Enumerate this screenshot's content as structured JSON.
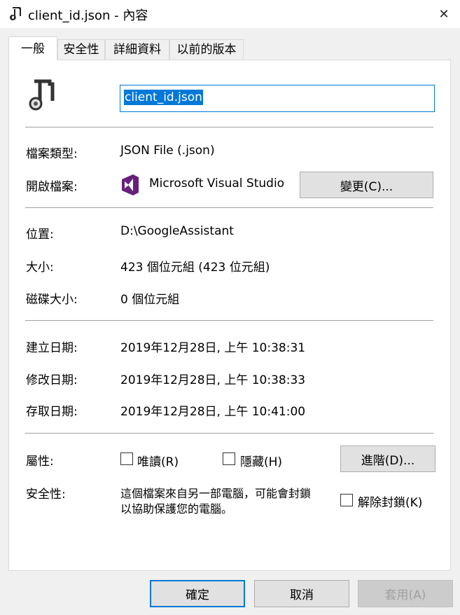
{
  "window": {
    "title": "client_id.json - 內容",
    "close_glyph": "✕"
  },
  "tabs": [
    {
      "label": "一般",
      "active": true
    },
    {
      "label": "安全性",
      "active": false
    },
    {
      "label": "詳細資料",
      "active": false
    },
    {
      "label": "以前的版本",
      "active": false
    }
  ],
  "file": {
    "name": "client_id.json",
    "icon": "music-note-file-icon"
  },
  "fields": {
    "type_label": "檔案類型:",
    "type_value": "JSON File (.json)",
    "opens_label": "開啟檔案:",
    "opens_value": "Microsoft Visual Studio",
    "change_button": "變更(C)...",
    "location_label": "位置:",
    "location_value": "D:\\GoogleAssistant",
    "size_label": "大小:",
    "size_value": "423 個位元組 (423 位元組)",
    "disk_label": "磁碟大小:",
    "disk_value": "0 個位元組",
    "created_label": "建立日期:",
    "created_value": "2019年12月28日, 上午 10:38:31",
    "modified_label": "修改日期:",
    "modified_value": "2019年12月28日, 上午 10:38:33",
    "accessed_label": "存取日期:",
    "accessed_value": "2019年12月28日, 上午 10:41:00",
    "attr_label": "屬性:",
    "readonly_label": "唯讀(R)",
    "hidden_label": "隱藏(H)",
    "advanced_button": "進階(D)...",
    "security_label": "安全性:",
    "security_line1": "這個檔案來自另一部電腦，可能會封鎖",
    "security_line2": "以協助保護您的電腦。",
    "unblock_label": "解除封鎖(K)"
  },
  "buttons": {
    "ok": "確定",
    "cancel": "取消",
    "apply": "套用(A)"
  },
  "colors": {
    "accent": "#0078d7",
    "vs_purple": "#68217a"
  }
}
